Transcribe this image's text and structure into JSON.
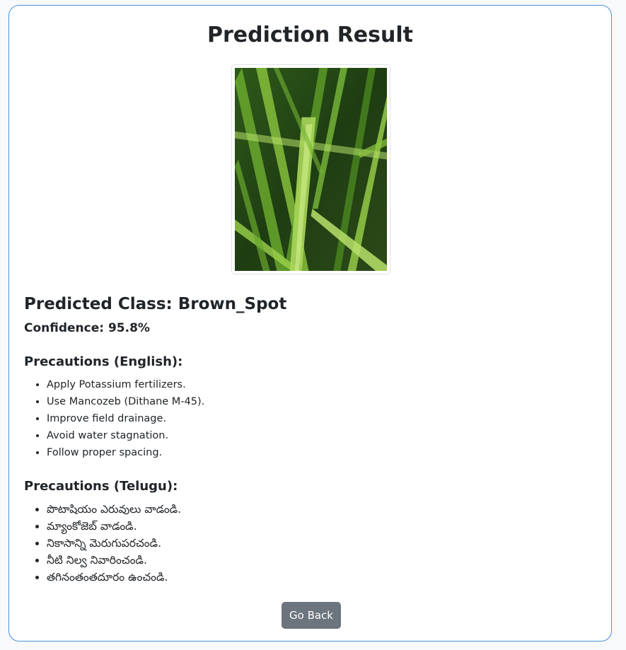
{
  "page": {
    "title": "Prediction Result"
  },
  "image": {
    "description_icon": "rice-leaf-photo"
  },
  "result": {
    "predicted_class": "Predicted Class: Brown_Spot",
    "confidence": "Confidence: 95.8%"
  },
  "precautions_english": {
    "heading": "Precautions (English):",
    "items": [
      "Apply Potassium fertilizers.",
      "Use Mancozeb (Dithane M-45).",
      "Improve field drainage.",
      "Avoid water stagnation.",
      "Follow proper spacing."
    ]
  },
  "precautions_telugu": {
    "heading": "Precautions (Telugu):",
    "items": [
      "పొటాషియం ఎరువులు వాడండి.",
      "మ్యాంకోజెబ్ వాడండి.",
      "నికాసాన్ని మెరుగుపరచండి.",
      "నీటి నిల్వ నివారించండి.",
      "తగినంతంతదూరం ఉంచండి."
    ]
  },
  "actions": {
    "back_label": "Go Back"
  },
  "colors": {
    "card_border": "#4a90d9",
    "button_bg": "#6c757d",
    "page_bg": "#f8f9fa"
  }
}
